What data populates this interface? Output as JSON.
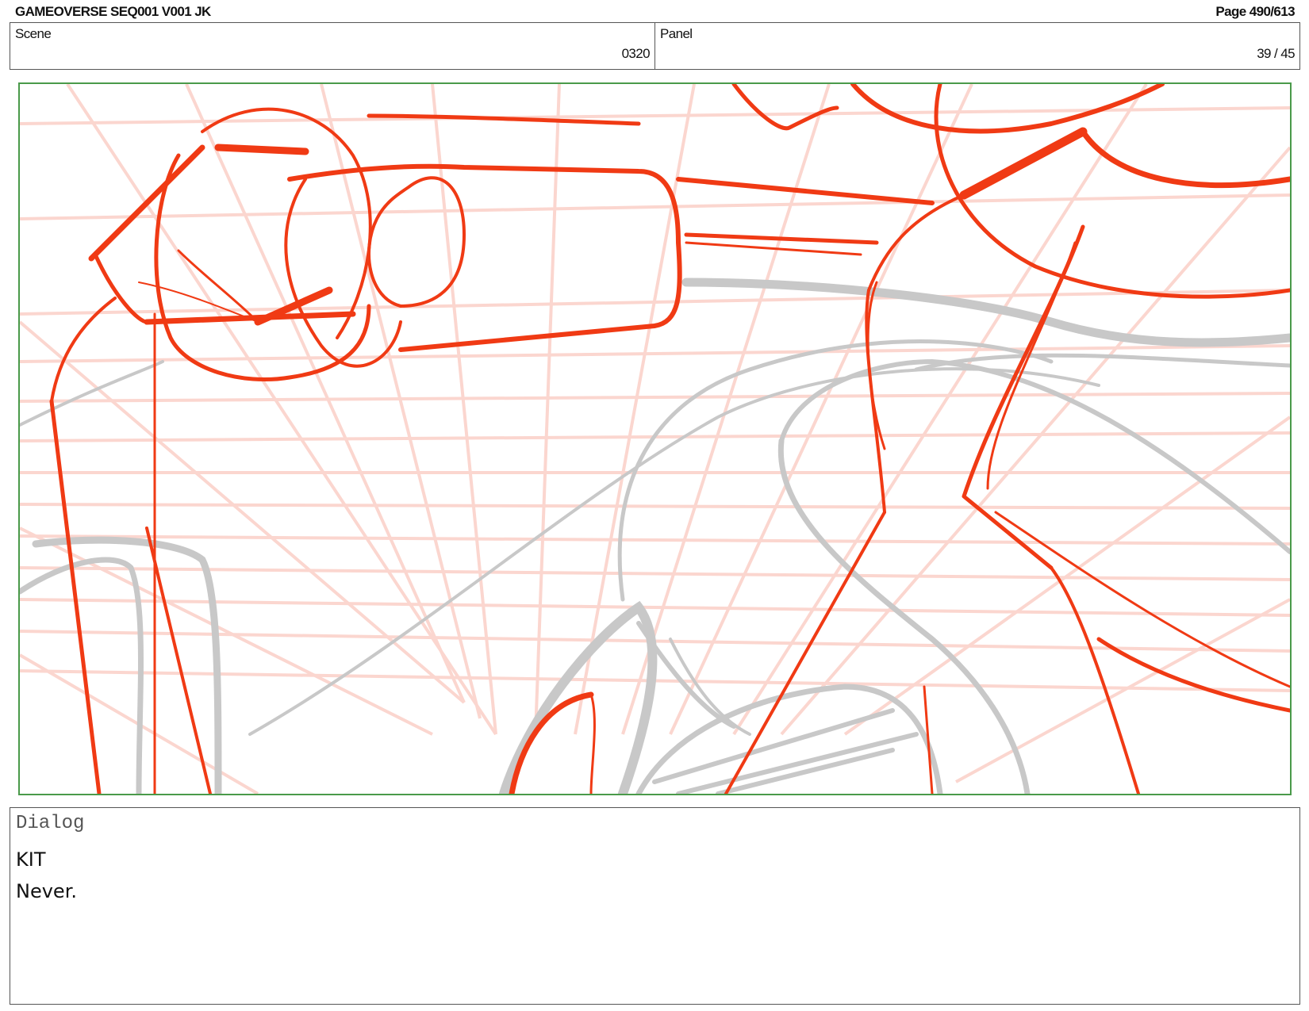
{
  "header": {
    "title": "GAMEOVERSE SEQ001 V001 JK",
    "page": "Page 490/613"
  },
  "info": {
    "scene_label": "Scene",
    "scene_value": "0320",
    "panel_label": "Panel",
    "panel_value": "39 / 45"
  },
  "panel": {
    "frame_color": "#4a9a4a",
    "sketch_color": "#f03a14",
    "grid_color": "#fbd6cf",
    "rough_color": "#c8c8c8"
  },
  "dialog": {
    "label": "Dialog",
    "speaker": "KIT",
    "line": "Never."
  }
}
